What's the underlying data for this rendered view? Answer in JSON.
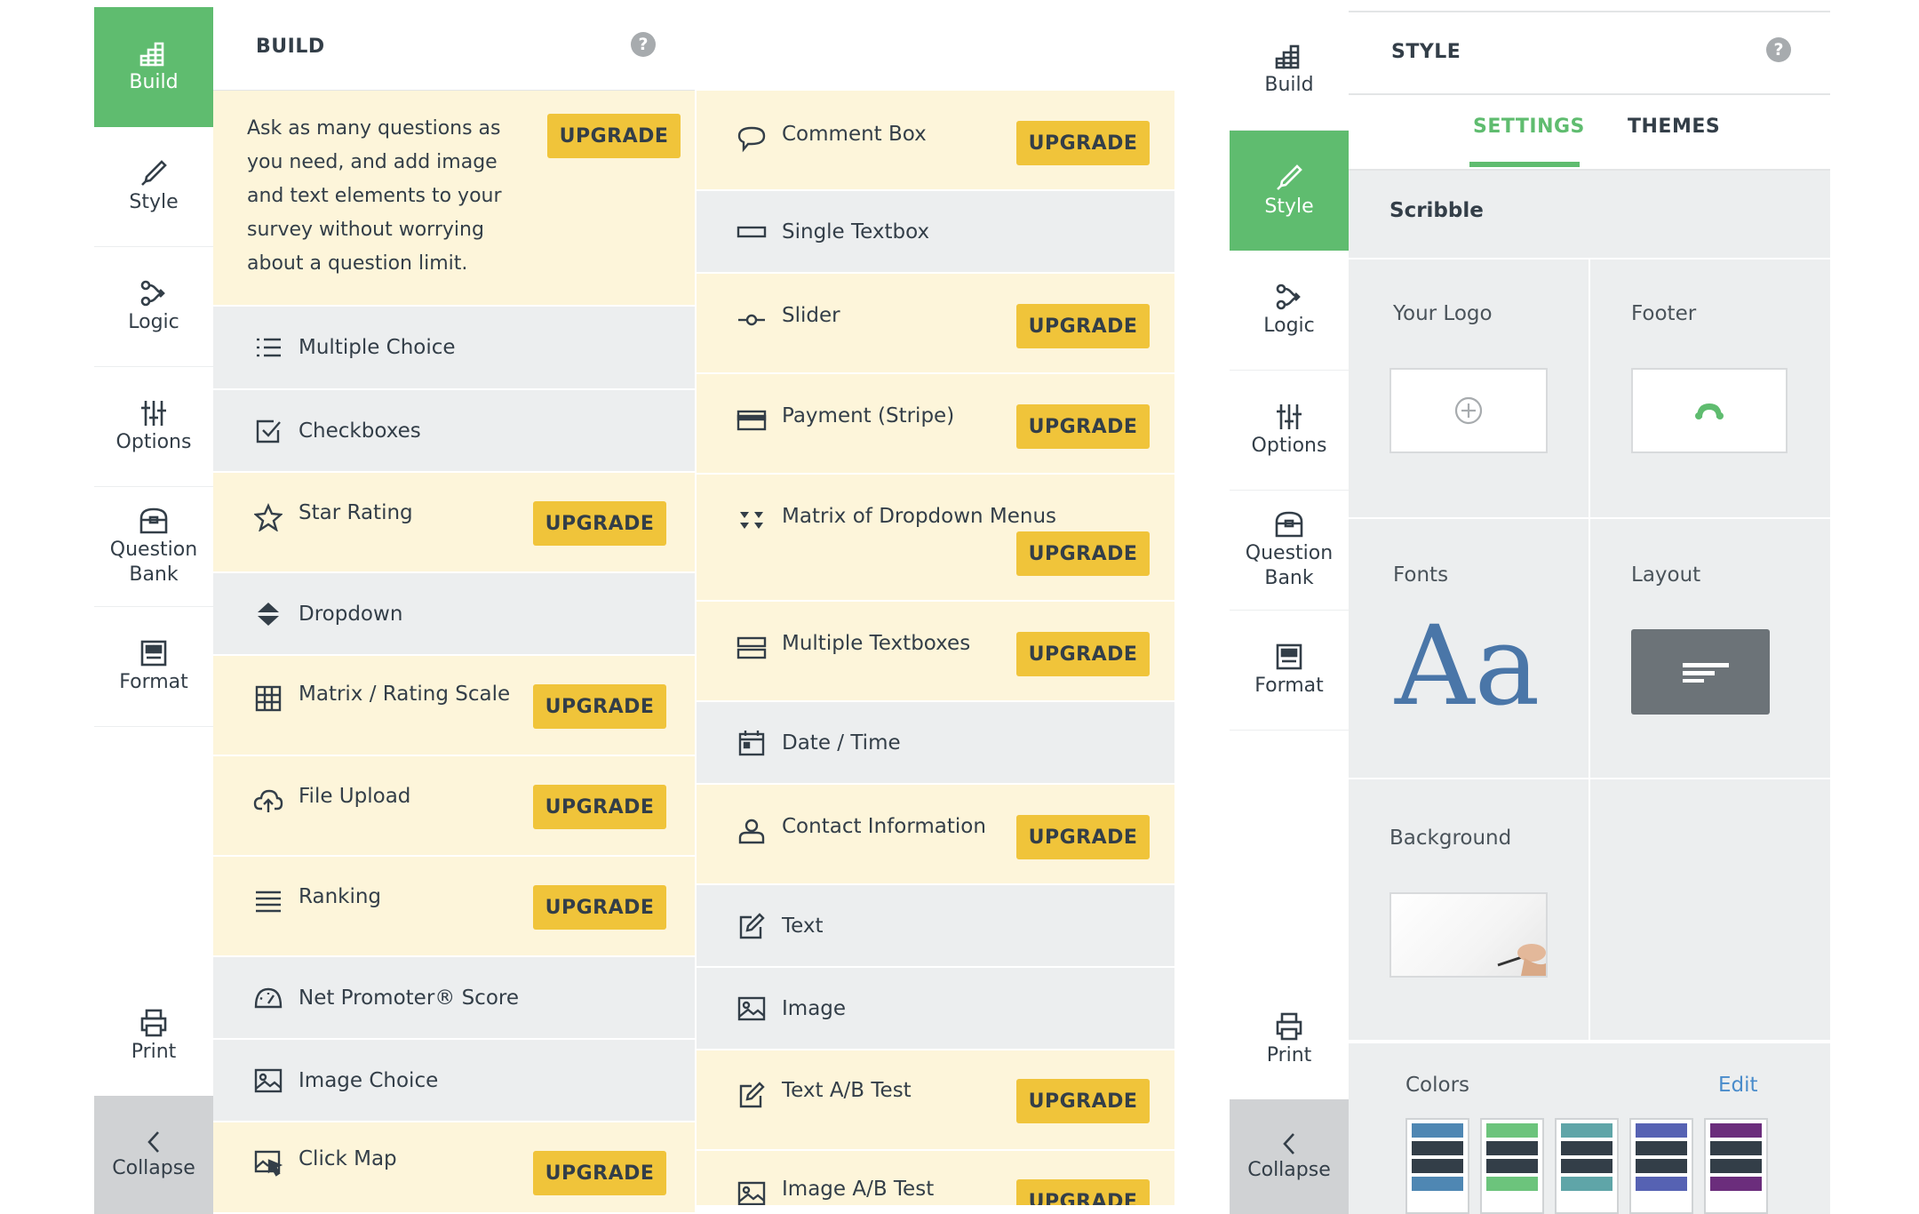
{
  "build_sidebar": {
    "items": [
      {
        "label": "Build",
        "icon": "build-icon"
      },
      {
        "label": "Style",
        "icon": "style-icon"
      },
      {
        "label": "Logic",
        "icon": "logic-icon"
      },
      {
        "label": "Options",
        "icon": "options-icon"
      },
      {
        "label_line1": "Question",
        "label_line2": "Bank",
        "icon": "question-bank-icon"
      },
      {
        "label": "Format",
        "icon": "format-icon"
      }
    ],
    "print_label": "Print",
    "collapse_label": "Collapse",
    "active": "Build"
  },
  "style_sidebar": {
    "active": "Style"
  },
  "build_panel": {
    "title": "BUILD",
    "help": "?",
    "promo_text": "Ask as many questions as you need, and add image and text elements to your survey without worrying about a question limit.",
    "upgrade_label": "UPGRADE",
    "left_items": [
      {
        "label": "Multiple Choice",
        "icon": "list-icon",
        "upgrade": false
      },
      {
        "label": "Checkboxes",
        "icon": "checkbox-icon",
        "upgrade": false
      },
      {
        "label": "Star Rating",
        "icon": "star-icon",
        "upgrade": true
      },
      {
        "label": "Dropdown",
        "icon": "dropdown-icon",
        "upgrade": false
      },
      {
        "label": "Matrix / Rating Scale",
        "icon": "grid-icon",
        "upgrade": true
      },
      {
        "label": "File Upload",
        "icon": "cloud-upload-icon",
        "upgrade": true
      },
      {
        "label": "Ranking",
        "icon": "ranking-icon",
        "upgrade": true
      },
      {
        "label": "Net Promoter® Score",
        "icon": "gauge-icon",
        "upgrade": false
      },
      {
        "label": "Image Choice",
        "icon": "image-icon",
        "upgrade": false
      },
      {
        "label": "Click Map",
        "icon": "click-map-icon",
        "upgrade": true
      }
    ],
    "right_items": [
      {
        "label": "Comment Box",
        "icon": "comment-icon",
        "upgrade": true
      },
      {
        "label": "Single Textbox",
        "icon": "textbox-icon",
        "upgrade": false
      },
      {
        "label": "Slider",
        "icon": "slider-icon",
        "upgrade": true
      },
      {
        "label": "Payment (Stripe)",
        "icon": "credit-card-icon",
        "upgrade": true
      },
      {
        "label": "Matrix of Dropdown Menus",
        "icon": "matrix-dropdown-icon",
        "upgrade": true
      },
      {
        "label": "Multiple Textboxes",
        "icon": "multi-textbox-icon",
        "upgrade": true
      },
      {
        "label": "Date / Time",
        "icon": "calendar-icon",
        "upgrade": false
      },
      {
        "label": "Contact Information",
        "icon": "contact-icon",
        "upgrade": true
      },
      {
        "label": "Text",
        "icon": "edit-icon",
        "upgrade": false
      },
      {
        "label": "Image",
        "icon": "image-icon",
        "upgrade": false
      },
      {
        "label": "Text A/B Test",
        "icon": "edit-icon",
        "upgrade": true
      },
      {
        "label": "Image A/B Test",
        "icon": "image-icon",
        "upgrade": true
      }
    ]
  },
  "style_panel": {
    "title": "STYLE",
    "help": "?",
    "tabs": [
      "SETTINGS",
      "THEMES"
    ],
    "active_tab": "SETTINGS",
    "theme_name": "Scribble",
    "your_logo_label": "Your Logo",
    "footer_label": "Footer",
    "fonts_label": "Fonts",
    "fonts_sample": "Aa",
    "layout_label": "Layout",
    "background_label": "Background",
    "colors_label": "Colors",
    "edit_label": "Edit"
  },
  "colors": {
    "build_active": "#5fbc6f",
    "upgrade": "#f0c43a",
    "promo_bg": "#fdf5da",
    "grey_row": "#eceeef",
    "accent_green": "#5fbc6f",
    "link_blue": "#4a8ccb",
    "fonts_blue": "#4a76a8",
    "swatch_accents": [
      "#4f87b3",
      "#6cc47c",
      "#5fa5a8",
      "#5662b3",
      "#6b2d7c"
    ]
  }
}
